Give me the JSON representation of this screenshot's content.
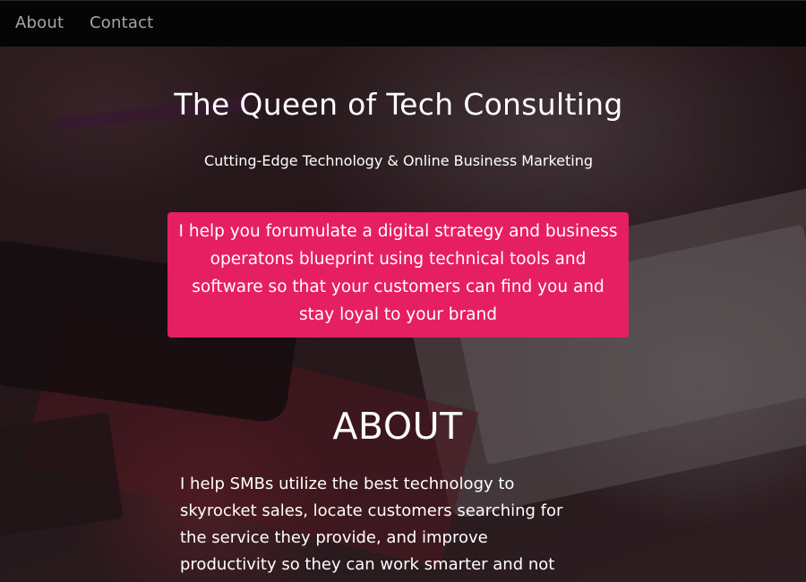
{
  "navbar": {
    "links": [
      {
        "label": "About"
      },
      {
        "label": "Contact"
      }
    ]
  },
  "hero": {
    "title": "The Queen of Tech Consulting",
    "subtitle": "Cutting-Edge Technology & Online Business Marketing",
    "pitch": "I help you forumulate a digital strategy and business operatons blueprint using technical tools and software so that your customers can find you and stay loyal to your brand"
  },
  "about": {
    "heading": "ABOUT",
    "body": "I help SMBs utilize the best technology to skyrocket sales, locate customers searching for the service they provide, and improve productivity so they can work smarter and not"
  },
  "colors": {
    "navbar_bg": "#050505",
    "nav_link": "#a6a6a6",
    "accent": "#e61f62",
    "text": "#ffffff"
  }
}
